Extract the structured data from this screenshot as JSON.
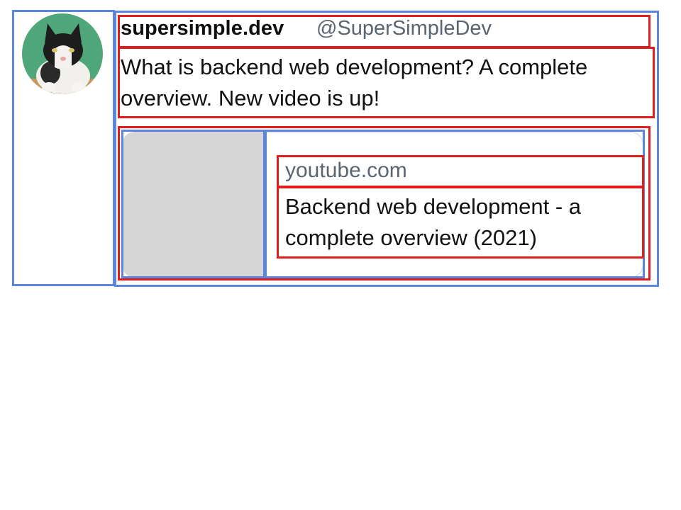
{
  "tweet": {
    "display_name": "supersimple.dev",
    "handle": "@SuperSimpleDev",
    "text": "What is backend web development? A complete overview. New video is up!",
    "avatar_icon": "cat-avatar-icon"
  },
  "card": {
    "domain": "youtube.com",
    "title": "Backend web development - a complete overview (2021)"
  },
  "colors": {
    "outline_blue": "#5a86dd",
    "outline_red": "#e01e1e",
    "muted_text": "#5a6570",
    "thumbnail_gray": "#d6d6d6",
    "avatar_bg": "#4fa67a"
  }
}
